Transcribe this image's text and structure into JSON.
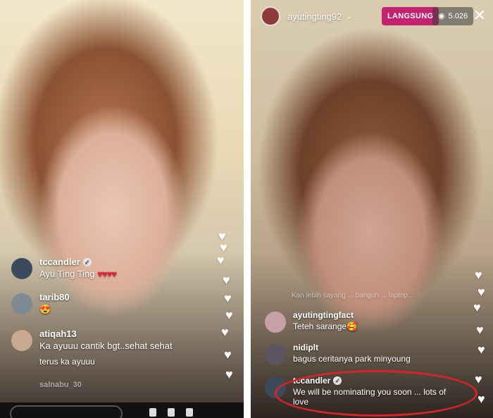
{
  "left_panel": {
    "comments": [
      {
        "username": "tccandler",
        "verified": true,
        "text": "Ayu Ting Ting",
        "avatar_color": "#3b4b5c"
      },
      {
        "username": "tarib80",
        "verified": false,
        "text": "😍",
        "avatar_color": "#7e8a93"
      },
      {
        "username": "atiqah13",
        "verified": false,
        "text": "Ka ayuuu cantik bgt..sehat sehat",
        "avatar_color": "#c9a98f"
      }
    ],
    "extra_line": "terus ka ayuuu",
    "faded_username": "salnabu_30"
  },
  "right_panel": {
    "topbar": {
      "username": "ayutingting92",
      "live_label": "LANGSUNG",
      "viewer_count": "5.026"
    },
    "faded_line": "Kan lebih sayang ... bangun ... laptop...",
    "comments": [
      {
        "username": "ayutingtingfact",
        "verified": false,
        "text": "Teteh sarange🥰",
        "avatar_color": "#c7a0a8"
      },
      {
        "username": "nidiplt",
        "verified": false,
        "text": "bagus ceritanya park minyoung",
        "avatar_color": "#5a5560"
      },
      {
        "username": "tccandler",
        "verified": true,
        "text": "We will be nominating you soon ... lots of love",
        "avatar_color": "#3b4b5c"
      }
    ]
  },
  "colors": {
    "live_badge": "#c4216e",
    "annotation": "#d9232a"
  },
  "icons": [
    "verified-badge-icon",
    "heart-icon",
    "eye-icon",
    "close-icon",
    "chevron-down-icon"
  ]
}
